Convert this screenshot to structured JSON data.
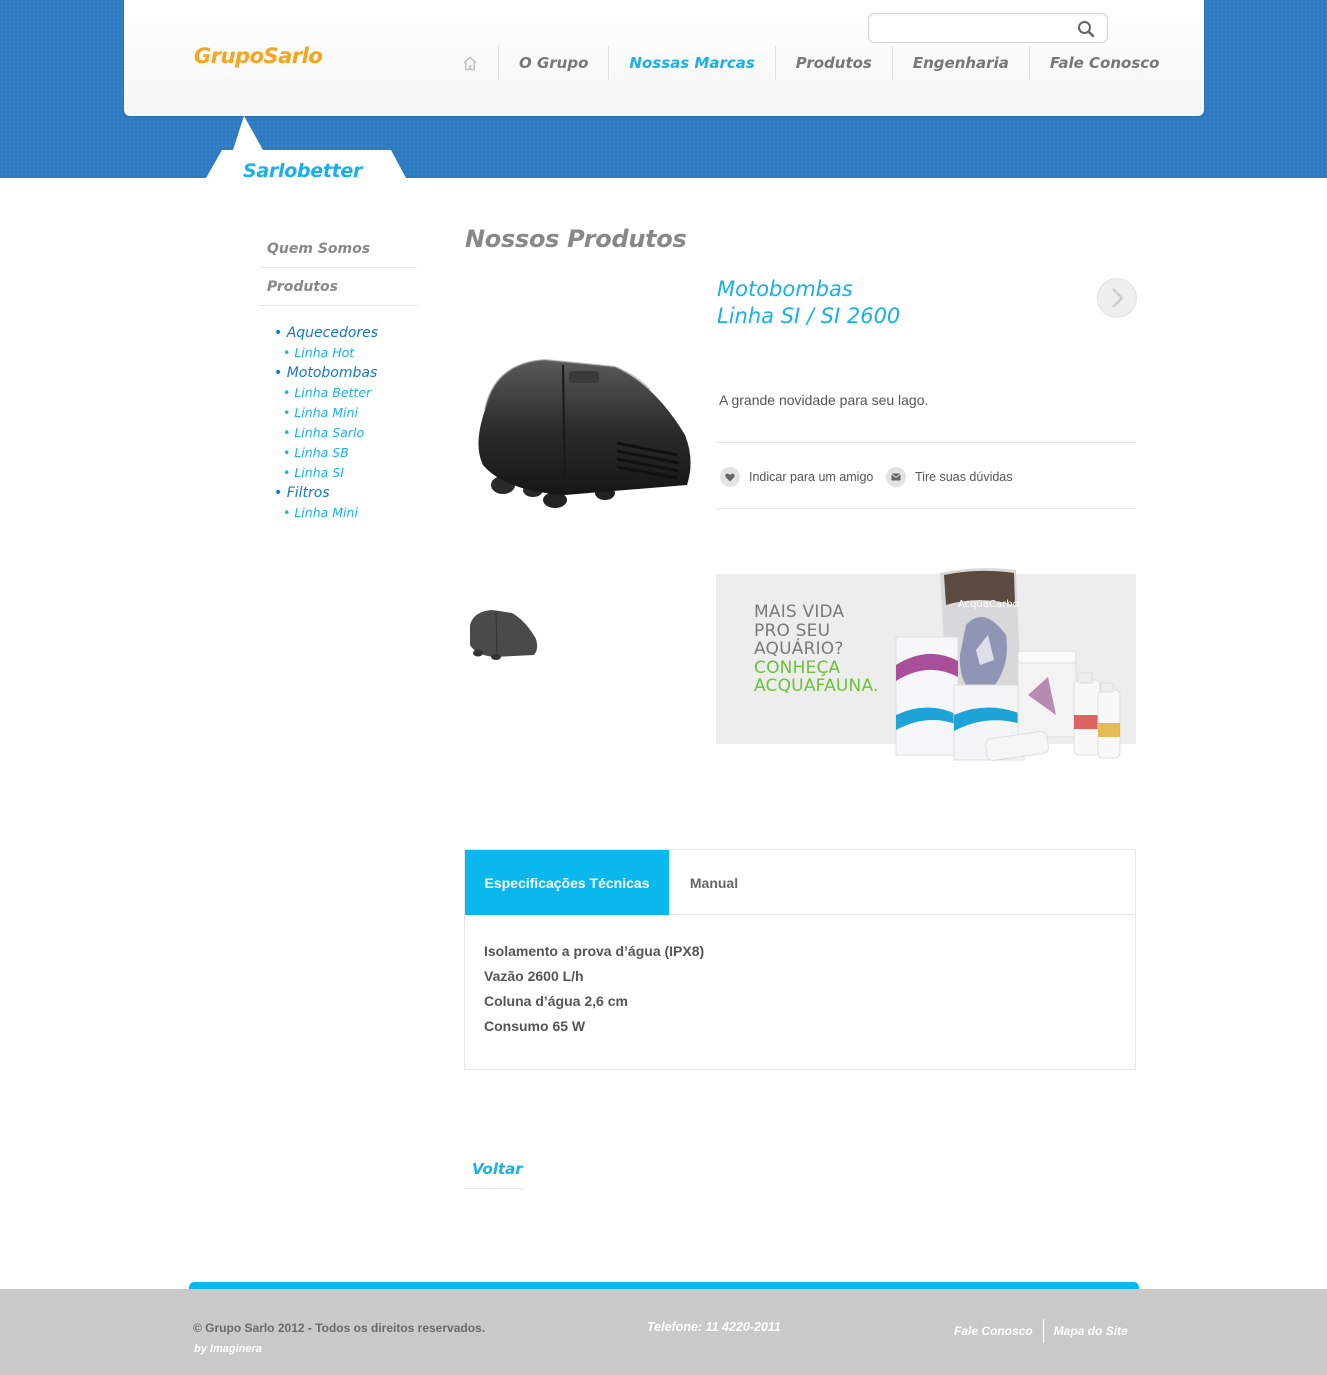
{
  "header": {
    "logo": "GrupoSarlo",
    "search": {
      "placeholder": "",
      "value": ""
    },
    "nav": [
      "O Grupo",
      "Nossas Marcas",
      "Produtos",
      "Engenharia",
      "Fale Conosco"
    ],
    "nav_active": "Nossas Marcas",
    "accent_color": "#1ab0e8",
    "logo_color": "#f5a51e",
    "band_color": "#2f7bc2"
  },
  "brand_tab": {
    "label": "Sarlobetter"
  },
  "sidebar": {
    "sections": [
      "Quem Somos",
      "Produtos"
    ],
    "tree": [
      {
        "label": "• Aquecedores",
        "children": [
          "• Linha Hot"
        ]
      },
      {
        "label": "• Motobombas",
        "children": [
          "• Linha Better",
          "• Linha Mini",
          "• Linha Sarlo",
          "• Linha SB",
          "• Linha SI"
        ]
      },
      {
        "label": "• Filtros",
        "children": [
          "• Linha Mini"
        ]
      }
    ]
  },
  "main": {
    "title": "Nossos Produtos",
    "product": {
      "category": "Motobombas",
      "name": "Linha SI / SI 2600",
      "description": "A grande novidade para seu lago.",
      "actions": [
        {
          "icon": "heart-icon",
          "label": "Indicar para um amigo"
        },
        {
          "icon": "mail-icon",
          "label": "Tire suas dúvidas"
        }
      ]
    },
    "banner": {
      "lines_gray": [
        "MAIS VIDA",
        "PRO SEU",
        "AQUÁRIO?"
      ],
      "lines_green": [
        "CONHEÇA",
        "ACQUAFAUNA."
      ],
      "product_label": "AcquaCarbo"
    },
    "tabs": [
      "Especificações Técnicas",
      "Manual"
    ],
    "tab_active": "Especificações Técnicas",
    "specs": [
      "Isolamento a prova d’água (IPX8)",
      "Vazão 2600 L/h",
      "Coluna d’água 2,6 cm",
      "Consumo 65 W"
    ],
    "back_label": "Voltar"
  },
  "footer": {
    "copyright": "© Grupo Sarlo 2012 - Todos os direitos reservados.",
    "by": "by Imaginera",
    "phone": "Telefone: 11 4220-2011",
    "links": [
      "Fale Conosco",
      "Mapa do Site"
    ]
  }
}
